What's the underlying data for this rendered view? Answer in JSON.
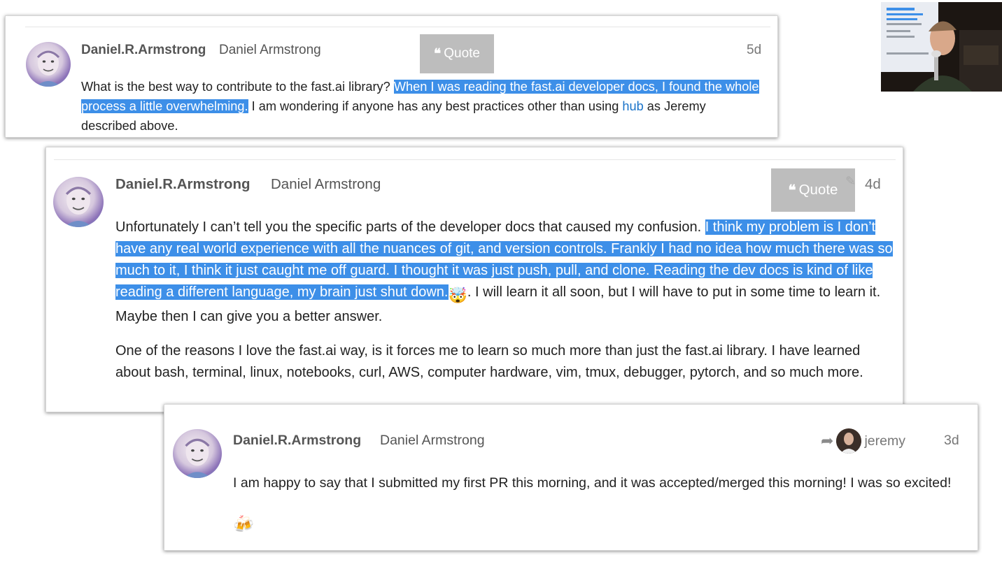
{
  "posts": [
    {
      "username": "Daniel.R.Armstrong",
      "full_name": "Daniel Armstrong",
      "age": "5d",
      "quote_label": "Quote",
      "segments": [
        {
          "text": "What is the best way to contribute to the fast.ai library? ",
          "style": "normal"
        },
        {
          "text": "When I was reading the fast.ai developer docs, I found the whole process a little overwhelming.",
          "style": "highlight"
        },
        {
          "text": " I am wondering if anyone has any best practices other than using ",
          "style": "normal"
        },
        {
          "text": "hub",
          "style": "link"
        },
        {
          "text": " as Jeremy described above.",
          "style": "normal"
        }
      ]
    },
    {
      "username": "Daniel.R.Armstrong",
      "full_name": "Daniel Armstrong",
      "age": "4d",
      "quote_label": "Quote",
      "paragraph1": [
        {
          "text": "Unfortunately I can’t tell you the specific parts of the developer docs that caused my confusion. ",
          "style": "normal"
        },
        {
          "text": "I think my problem is I don’t have any real world experience with all the nuances of git, and version controls. Frankly I had no idea how much there was so much to it, I think it just caught me off guard. I thought it was just push, pull, and clone. Reading the dev docs is kind of like reading a different language, my brain just shut down.",
          "style": "highlight"
        },
        {
          "text": "🤯",
          "style": "emoji"
        },
        {
          "text": ". I will learn it all soon, but I will have to put in some time to learn it. Maybe then I can give you a better answer.",
          "style": "normal"
        }
      ],
      "paragraph2": "One of the reasons I love the fast.ai way, is it forces me to learn so much more than just the fast.ai library. I have learned about bash, terminal, linux, notebooks, curl, AWS, computer hardware, vim, tmux, debugger, pytorch, and so much more."
    },
    {
      "username": "Daniel.R.Armstrong",
      "full_name": "Daniel Armstrong",
      "age": "3d",
      "reply_to": "jeremy",
      "text": "I am happy to say that I submitted my first PR this morning, and it was accepted/merged this morning! I was so excited!",
      "emoji": "🍻"
    }
  ],
  "icons": {
    "quote": "quote-icon",
    "reply": "reply-arrow-icon",
    "avatar": "avatar-icon"
  },
  "colors": {
    "highlight": "#3d8fe8",
    "link": "#1a73c9",
    "quote_button": "#bdbdbd"
  }
}
